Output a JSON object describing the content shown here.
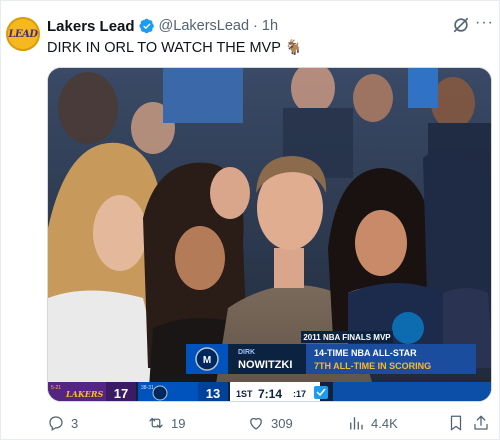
{
  "post": {
    "avatar_text": "LEAD",
    "display_name": "Lakers Lead",
    "handle": "@LakersLead",
    "separator": "·",
    "time": "1h",
    "text": "DIRK IN ORL TO WATCH THE MVP 🐐"
  },
  "scorebug": {
    "caption": "2011 NBA FINALS MVP",
    "player_first": "DIRK",
    "player_last": "NOWITZKI",
    "line1": "14-TIME NBA ALL-STAR",
    "line2": "7TH ALL-TIME IN SCORING",
    "away_record": "5-21",
    "away_team": "LAKERS",
    "away_score": "17",
    "home_record": "38-31",
    "home_score": "13",
    "quarter": "1ST",
    "clock": "7:14",
    "shot_clock": ":17",
    "badge_text": "ORLANDO"
  },
  "actions": {
    "replies": "3",
    "reposts": "19",
    "likes": "309",
    "views": "4.4K"
  },
  "colors": {
    "verified": "#1d9bf0",
    "avatar_bg": "#f5b81e",
    "lakers_purple": "#552583",
    "lakers_gold": "#fdb927",
    "mavs_blue": "#0053bc",
    "bug_navy": "#0b2240"
  },
  "icons": {
    "verified": "verified-badge-icon",
    "grok": "grok-icon",
    "more": "more-icon",
    "reply": "reply-icon",
    "repost": "repost-icon",
    "like": "like-icon",
    "views": "views-icon",
    "bookmark": "bookmark-icon",
    "share": "share-icon"
  }
}
